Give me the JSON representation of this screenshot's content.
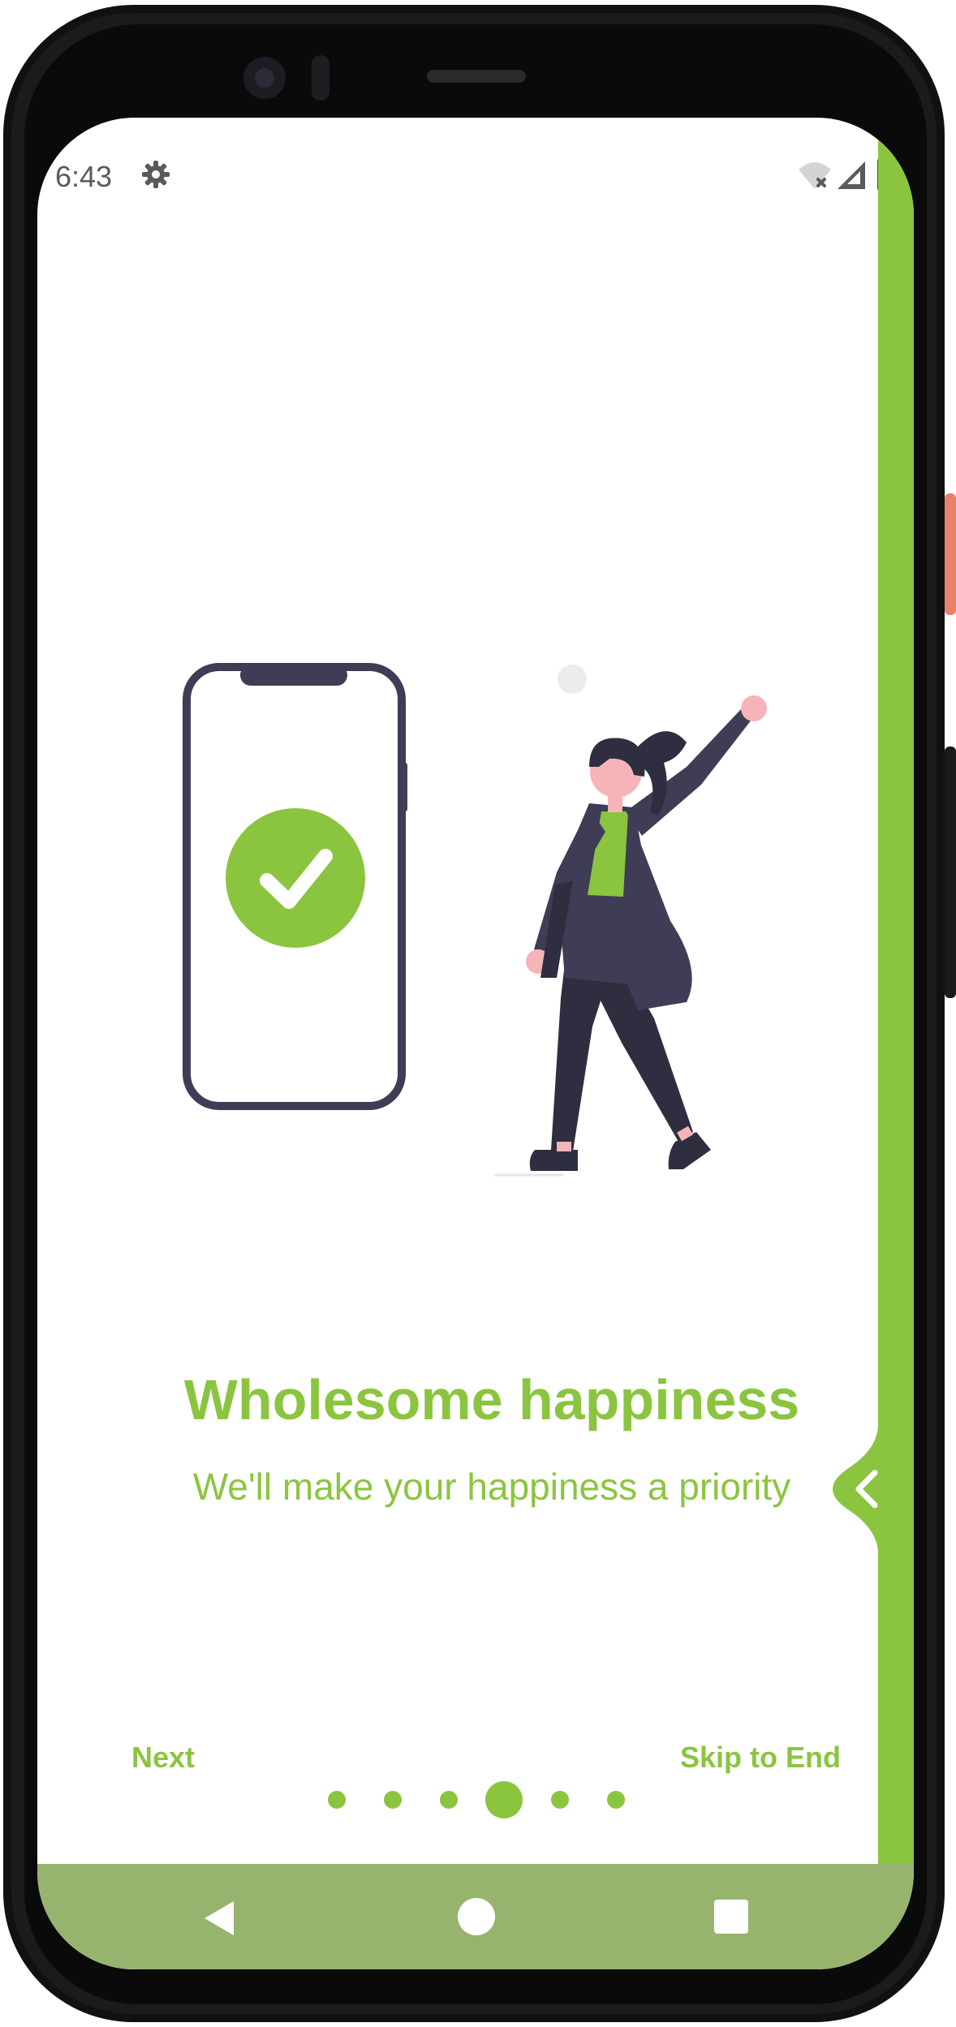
{
  "status_bar": {
    "time": "6:43",
    "icons": [
      "settings-icon",
      "wifi-off-icon",
      "signal-icon",
      "battery-icon"
    ]
  },
  "onboarding": {
    "title": "Wholesome happiness",
    "subtitle": "We'll make your happiness a priority",
    "next_label": "Next",
    "skip_label": "Skip to End",
    "pager": {
      "total_pages": 6,
      "current_page": 4
    }
  },
  "navigation_bar": {
    "icons": [
      "back-icon",
      "home-icon",
      "recents-icon"
    ]
  },
  "colors": {
    "accent": "#8bc540",
    "nav_bar": "#97b46f",
    "illustration_dark": "#3f3d56",
    "skin": "#f7b4b8"
  }
}
